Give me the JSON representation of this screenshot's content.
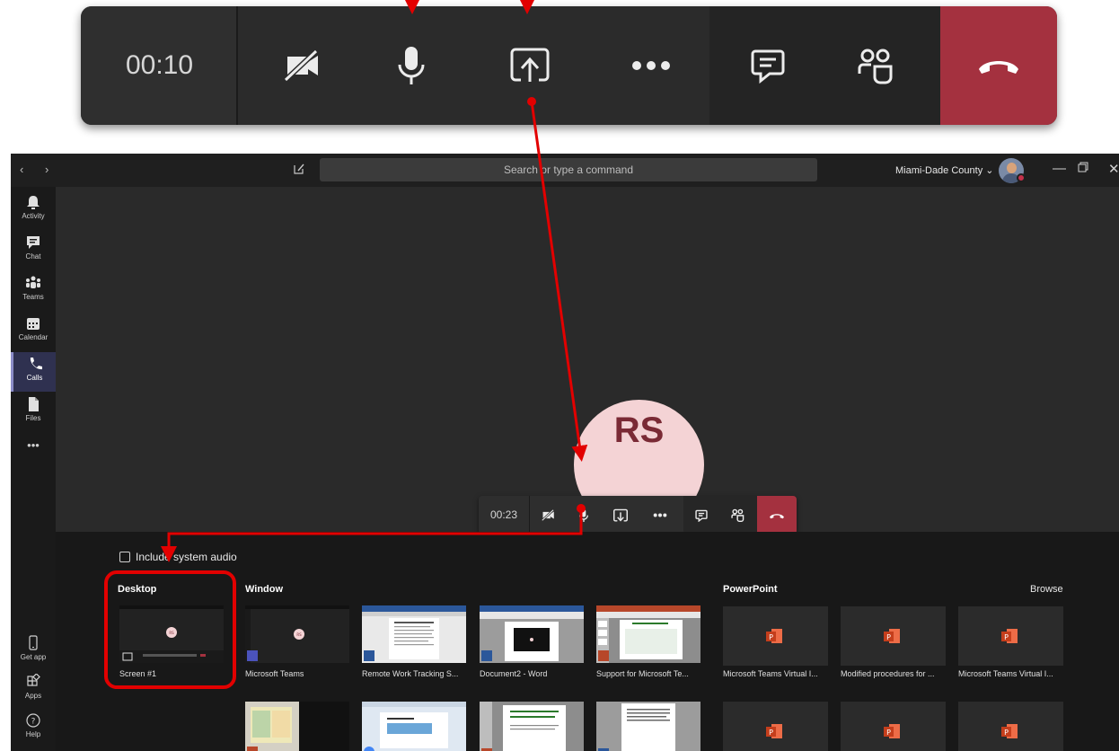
{
  "zoom_toolbar": {
    "timer": "00:10",
    "buttons": [
      {
        "name": "camera-off-icon"
      },
      {
        "name": "microphone-icon"
      },
      {
        "name": "share-screen-icon"
      },
      {
        "name": "more-actions-icon"
      },
      {
        "name": "chat-icon"
      },
      {
        "name": "participants-icon"
      },
      {
        "name": "hang-up-icon"
      }
    ]
  },
  "titlebar": {
    "search_placeholder": "Search or type a command",
    "org_name": "Miami-Dade County ⌄"
  },
  "rail": {
    "items": [
      {
        "label": "Activity",
        "icon": "bell-icon"
      },
      {
        "label": "Chat",
        "icon": "chat-icon"
      },
      {
        "label": "Teams",
        "icon": "teams-icon"
      },
      {
        "label": "Calendar",
        "icon": "calendar-icon"
      },
      {
        "label": "Calls",
        "icon": "phone-icon",
        "active": true
      },
      {
        "label": "Files",
        "icon": "file-icon"
      }
    ],
    "more": "•••",
    "bottom": [
      {
        "label": "Get app",
        "icon": "phone-device-icon"
      },
      {
        "label": "Apps",
        "icon": "apps-icon"
      },
      {
        "label": "Help",
        "icon": "help-icon"
      }
    ]
  },
  "stage": {
    "initials": "RS",
    "mini_timer": "00:23"
  },
  "share_tray": {
    "include_audio_label": "Include system audio",
    "desktop_heading": "Desktop",
    "window_heading": "Window",
    "powerpoint_heading": "PowerPoint",
    "browse_label": "Browse",
    "desktop_caption": "Screen #1",
    "window_captions": [
      "Microsoft Teams",
      "Remote Work Tracking S...",
      "Document2 - Word",
      "Support for Microsoft Te..."
    ],
    "powerpoint_captions": [
      "Microsoft Teams Virtual I...",
      "Modified procedures for ...",
      "Microsoft Teams Virtual I..."
    ],
    "thumb_initials": "RS"
  },
  "colors": {
    "hangup": "#a4313f",
    "annotation": "#e20000",
    "active_rail": "#8b8cc7"
  }
}
